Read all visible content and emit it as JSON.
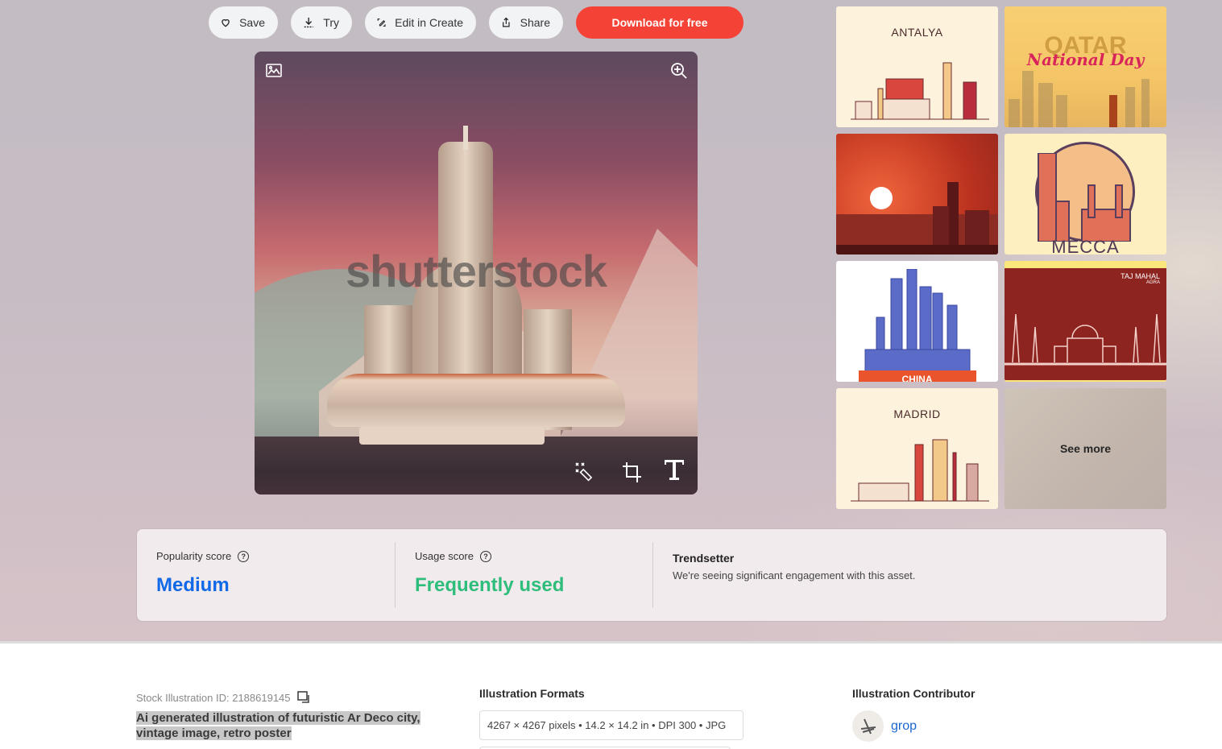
{
  "toolbar": {
    "save_label": "Save",
    "try_label": "Try",
    "edit_label": "Edit in Create",
    "share_label": "Share",
    "download_label": "Download for free",
    "download_color": "#f44336"
  },
  "main_image": {
    "watermark": "shutterstock",
    "alt": "Ai generated illustration of futuristic Ar Deco city, vintage image, retro poster",
    "overlay_icons": [
      "image-icon",
      "zoom-in-icon",
      "magic-wand-icon",
      "crop-icon",
      "text-icon"
    ]
  },
  "related": {
    "items": [
      {
        "label": "ANTALYA",
        "style": "line-art skyline"
      },
      {
        "label": "QATAR",
        "sublabel": "National Day",
        "style": "golden skyline"
      },
      {
        "label": "",
        "style": "red sunset skyline"
      },
      {
        "label": "MECCA",
        "style": "circle emblem skyline"
      },
      {
        "label": "CHINA",
        "style": "blue skyline with ribbon"
      },
      {
        "label": "TAJ MAHAL",
        "sublabel": "AGRA",
        "style": "dark red monument"
      },
      {
        "label": "MADRID",
        "style": "line-art skyline"
      }
    ],
    "see_more_label": "See more"
  },
  "scores": {
    "popularity": {
      "label": "Popularity score",
      "value": "Medium",
      "color": "#1169e8"
    },
    "usage": {
      "label": "Usage score",
      "value": "Frequently used",
      "color": "#2ebd7a"
    },
    "trend": {
      "title": "Trendsetter",
      "description": "We're seeing significant engagement with this asset."
    }
  },
  "details": {
    "stock_id_label": "Stock Illustration ID: 2188619145",
    "description": "Ai generated illustration of futuristic Ar Deco city, vintage image, retro poster",
    "formats_title": "Illustration Formats",
    "format_option": "4267 × 4267 pixels • 14.2 × 14.2 in • DPI 300 • JPG",
    "contributor_title": "Illustration Contributor",
    "contributor_name": "grop"
  }
}
